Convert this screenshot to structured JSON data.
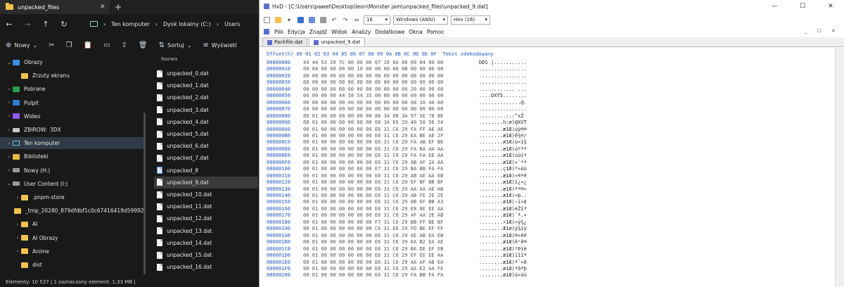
{
  "explorer": {
    "tab_title": "unpacked_files",
    "tab_close": "✕",
    "new_tab": "+",
    "breadcrumbs": [
      "Ten komputer",
      "Dysk lokalny (C:)",
      "Users"
    ],
    "toolbar": {
      "new_label": "Nowy",
      "sort_label": "Sortuj",
      "view_label": "Wyświetl"
    },
    "tree": [
      {
        "label": "Obrazy",
        "icon": "pictures",
        "chev": "⌄"
      },
      {
        "label": "Zrzuty ekranu",
        "icon": "folder",
        "chev": ""
      },
      {
        "label": "Pobrane",
        "icon": "downloads",
        "chev": "›"
      },
      {
        "label": "Pulpit",
        "icon": "desktop",
        "chev": "›"
      },
      {
        "label": "Wideo",
        "icon": "video",
        "chev": "›"
      },
      {
        "label": "ZBIROW:",
        "icon": "drive",
        "chev": "›"
      },
      {
        "label": "Ten komputer",
        "icon": "pc",
        "chev": "›"
      },
      {
        "label": "Biblioteki",
        "icon": "library",
        "chev": "›"
      },
      {
        "label": "Nowy (H:)",
        "icon": "netdrive",
        "chev": "›"
      },
      {
        "label": "User Content (I:)",
        "icon": "netdrive",
        "chev": "⌄"
      },
      {
        "label": ".pnpm-store",
        "icon": "folder",
        "chev": "›"
      },
      {
        "label": "_tmp_20280_879dfdbf1c0c67416419d59992f059",
        "icon": "folder",
        "chev": ""
      },
      {
        "label": "AI",
        "icon": "folder",
        "chev": "›"
      },
      {
        "label": "AI Obrazy",
        "icon": "folder",
        "chev": "›"
      },
      {
        "label": "Anime",
        "icon": "folder",
        "chev": "›"
      },
      {
        "label": "dist",
        "icon": "folder",
        "chev": ""
      }
    ],
    "tree_extra": "3DX",
    "column_header": "Nazwa",
    "files": [
      "unpacked_0.dat",
      "unpacked_1.dat",
      "unpacked_2.dat",
      "unpacked_3.dat",
      "unpacked_4.dat",
      "unpacked_5.dat",
      "unpacked_6.dat",
      "unpacked_7.dat",
      "unpacked_8",
      "unpacked_9.dat",
      "unpacked_10.dat",
      "unpacked_11.dat",
      "unpacked_12.dat",
      "unpacked_13.dat",
      "unpacked_14.dat",
      "unpacked_15.dat",
      "unpacked_16.dat"
    ],
    "selected_file_index": 9,
    "selected_tree_index": 6,
    "status": "Elementy: 10 537  |  1 zaznaczony element. 1,33 MB  |"
  },
  "hxd": {
    "title": "HxD - [C:\\Users\\pawel\\Desktop\\leon\\Monster jam\\unpacked_files\\unpacked_9.dat]",
    "window_buttons": [
      "—",
      "☐",
      "✕"
    ],
    "toolbar": {
      "bytes_per_row": "16",
      "charset": "Windows (ANSI)",
      "base": "Hex (16)"
    },
    "menu": [
      "Plik",
      "Edycja",
      "Znajdź",
      "Widok",
      "Analizy",
      "Dodatkowe",
      "Okna",
      "Pomoc"
    ],
    "mdi_buttons": "_ ☐ ✕",
    "tabs": [
      "Packfile.dat",
      "unpacked_9.dat"
    ],
    "active_tab": 1,
    "header": "Offset(h) 00 01 02 03 04 05 06 07 08 09 0A 0B 0C 0D 0E 0F  Tekst zdekodowany",
    "rows": [
      [
        "00000000",
        "44 44 53 20 7C 00 00 00 07 10 0A 00 00 04 00 00",
        "DDS |..........."
      ],
      [
        "00000010",
        "00 04 00 00 00 00 10 00 00 00 00 0B 00 00 00 00",
        "................"
      ],
      [
        "00000020",
        "00 00 00 00 00 00 00 00 00 00 00 00 00 00 00 00",
        "................"
      ],
      [
        "00000030",
        "00 00 00 00 00 00 00 00 00 00 00 00 00 00 00 00",
        "................"
      ],
      [
        "00000040",
        "00 00 00 00 00 00 00 00 00 00 00 00 20 00 00 00",
        "............ ..."
      ],
      [
        "00000050",
        "04 00 00 00 44 58 54 35 00 00 00 00 00 00 00 00",
        "....DXT5........"
      ],
      [
        "00000060",
        "00 00 00 00 00 00 00 00 00 00 00 00 08 10 40 00",
        "..............@."
      ],
      [
        "00000070",
        "00 00 00 00 00 00 00 00 00 00 00 00 00 00 00 00",
        "................"
      ],
      [
        "00000080",
        "00 01 00 00 00 00 00 00 88 3A 08 3A 97 5E 78 8E",
        ".........:.:^xŽ"
      ],
      [
        "00000090",
        "00 01 00 00 00 00 00 00 68 3A E6 29 40 58 56 54",
        "........h:æ)@XVT"
      ],
      [
        "000000A0",
        "00 01 00 00 00 00 00 00 E6 31 C6 29 FA FF AE AE",
        "........æ1Æ)úÿ®®"
      ],
      [
        "000000B0",
        "00 01 00 00 00 00 00 00 E6 31 C6 29 EA BE AE 2F",
        "........æ1Æ)ê¾®/"
      ],
      [
        "000000C0",
        "00 01 00 00 00 00 00 00 E6 31 C6 29 FA AB EF BE",
        "........æ1Æ)ú«ï¾"
      ],
      [
        "000000D0",
        "00 01 00 00 00 00 00 00 E6 31 C6 29 FA BA AA AA",
        "........æ1Æ)úºªª"
      ],
      [
        "000000E0",
        "00 01 00 00 00 00 00 00 E6 31 C6 29 FA FA EE AA",
        "........æ1Æ)úúîª"
      ],
      [
        "000000F0",
        "00 01 00 00 00 00 00 00 E6 31 C6 29 AB AF 2A AA",
        "........æ1Æ)«¯*ª"
      ],
      [
        "00000100",
        "00 01 00 00 00 00 00 00 E7 31 C6 29 BA BB FA FA",
        "........ç1Æ)º»úú"
      ],
      [
        "00000110",
        "00 01 00 00 00 00 00 00 E6 31 C6 29 AB AE AA EB",
        "........æ1Æ)«®ªë"
      ],
      [
        "00000120",
        "00 01 00 00 00 00 00 00 E6 31 C6 29 EF BF BB BF",
        "........æ1Æ)ï¿»¿"
      ],
      [
        "00000130",
        "00 01 00 00 00 00 00 00 E6 31 C6 29 AA AA AE AB",
        "........æ1Æ)ªª®«"
      ],
      [
        "00000140",
        "00 01 00 00 00 00 00 00 E6 31 C6 29 AB FE 2E 2E",
        "........æ1Æ)«þ.."
      ],
      [
        "00000150",
        "00 01 00 00 00 00 00 00 E6 31 C6 29 8B EF BB A3",
        "........æ1Æ)‹ï»£"
      ],
      [
        "00000160",
        "00 01 00 00 00 00 00 00 E6 31 C6 29 E8 8E EE AA",
        "........æ1Æ)èŽîª"
      ],
      [
        "00000170",
        "00 01 00 00 00 00 00 00 E6 31 C6 29 AF AA 2E AB",
        "........æ1Æ)¯ª.«"
      ],
      [
        "00000180",
        "00 01 00 00 00 00 00 00 F7 31 C6 29 BB FF BE BF",
        "........÷1Æ)»ÿ¾¿"
      ],
      [
        "00000190",
        "00 01 00 00 00 00 00 00 C6 31 E6 29 FD BE EF FF",
        "........Æ1æ)ý¾ïÿ"
      ],
      [
        "000001A0",
        "00 01 00 00 00 00 00 00 E6 31 C6 29 AE AB EA EB",
        "........æ1Æ)®«êë"
      ],
      [
        "000001B0",
        "00 01 00 00 00 00 00 00 E6 31 C6 29 EA B2 EA AE",
        "........æ1Æ)ê²ê®"
      ],
      [
        "000001C0",
        "00 01 00 00 00 00 00 00 E6 31 C6 29 BA DE EF EB",
        "........æ1Æ)ºÞïë"
      ],
      [
        "000001D0",
        "00 01 00 00 00 00 00 00 E6 31 C6 29 EF EE EE AA",
        "........æ1Æ)ïîîª"
      ],
      [
        "000001E0",
        "00 01 00 00 00 00 00 00 E6 31 C6 29 AA AF AB EA",
        "........æ1Æ)ª¯«ê"
      ],
      [
        "000001F0",
        "00 01 00 00 00 00 00 00 E6 31 C6 29 AA E2 AA FE",
        "........æ1Æ)ªâªþ"
      ],
      [
        "00000200",
        "00 01 00 00 00 00 00 00 E6 31 C6 29 FA BB FA FA",
        "........æ1Æ)ú»úú"
      ]
    ]
  }
}
